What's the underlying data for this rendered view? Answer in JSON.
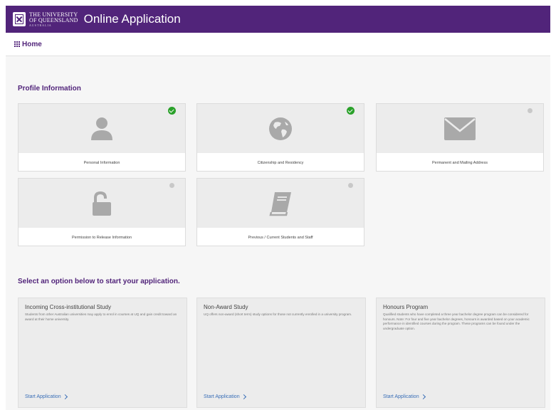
{
  "header": {
    "university_line1": "THE UNIVERSITY",
    "university_line2": "OF QUEENSLAND",
    "university_line3": "AUSTRALIA",
    "app_title": "Online Application"
  },
  "nav": {
    "home_label": "Home"
  },
  "profile": {
    "title": "Profile Information",
    "tiles": [
      {
        "label": "Personal Information",
        "icon": "person-icon",
        "complete": true
      },
      {
        "label": "Citizenship and Residency",
        "icon": "globe-icon",
        "complete": true
      },
      {
        "label": "Permanent and Mailing Address",
        "icon": "envelope-icon",
        "complete": false
      },
      {
        "label": "Permission to Release Information",
        "icon": "unlock-icon",
        "complete": false
      },
      {
        "label": "Previous / Current Students and Staff",
        "icon": "book-icon",
        "complete": false
      }
    ]
  },
  "options": {
    "title": "Select an option below to start your application.",
    "cards": [
      {
        "title": "Incoming Cross-institutional Study",
        "description": "Students from other Australian universities may apply to enrol in courses at UQ and gain credit toward an award at their home university.",
        "link": "Start Application"
      },
      {
        "title": "Non-Award Study",
        "description": "UQ offers non-award (short term) study options for those not currently enrolled in a university program.",
        "link": "Start Application"
      },
      {
        "title": "Honours Program",
        "description": "Qualified students who have completed a three year bachelor degree program can be considered for honours. Note: For four and five year bachelor degrees, honours is awarded based on your academic performance in identified courses during the program. These programs can be found under the undergraduate option.",
        "link": "Start Application"
      }
    ]
  },
  "colors": {
    "brand": "#51247a",
    "complete": "#2aa12a",
    "pending": "#c8c8c8",
    "link": "#3a6fb7",
    "icon": "#a9a9a9"
  }
}
